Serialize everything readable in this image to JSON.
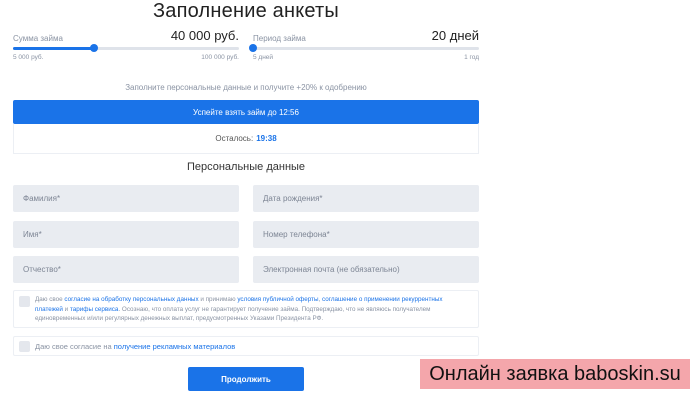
{
  "page_title": "Заполнение анкеты",
  "loan_amount": {
    "label": "Сумма займа",
    "value": "40 000 руб.",
    "min_label": "5 000 руб.",
    "max_label": "100 000 руб.",
    "fraction": 0.36
  },
  "loan_period": {
    "label": "Период займа",
    "value": "20 дней",
    "min_label": "5 дней",
    "max_label": "1 год",
    "fraction": 0.0
  },
  "hint": "Заполните персональные данные и получите +20% к одобрению",
  "banner": "Успейте взять займ до 12:56",
  "timer": {
    "label": "Осталось:",
    "value": "19:38"
  },
  "section_title": "Персональные данные",
  "fields": {
    "last_name": "Фамилия*",
    "birth_date": "Дата рождения*",
    "first_name": "Имя*",
    "phone": "Номер телефона*",
    "middle_name": "Отчество*",
    "email": "Электронная почта (не обязательно)"
  },
  "consent1": {
    "p1": "Даю свое ",
    "l1": "согласие на обработку персональных данных",
    "p2": " и принимаю ",
    "l2": "условия публичной оферты",
    "p3": ", ",
    "l3": "соглашение о применении рекуррентных платежей",
    "p4": " и ",
    "l4": "тарифы сервиса",
    "p5": ". Осознаю, что оплата услуг не гарантирует получение займа. Подтверждаю, что не являюсь получателем единовременных и/или регулярных денежных выплат, предусмотренных Указами Президента РФ."
  },
  "consent2": {
    "p1": "Даю свое согласие на ",
    "l1": "получение рекламных материалов"
  },
  "submit": "Продолжить",
  "watermark": "Онлайн заявка baboskin.su",
  "colors": {
    "accent": "#1a73e8",
    "field_bg": "#e9ecf1",
    "watermark_bg": "#f4a6ab"
  }
}
